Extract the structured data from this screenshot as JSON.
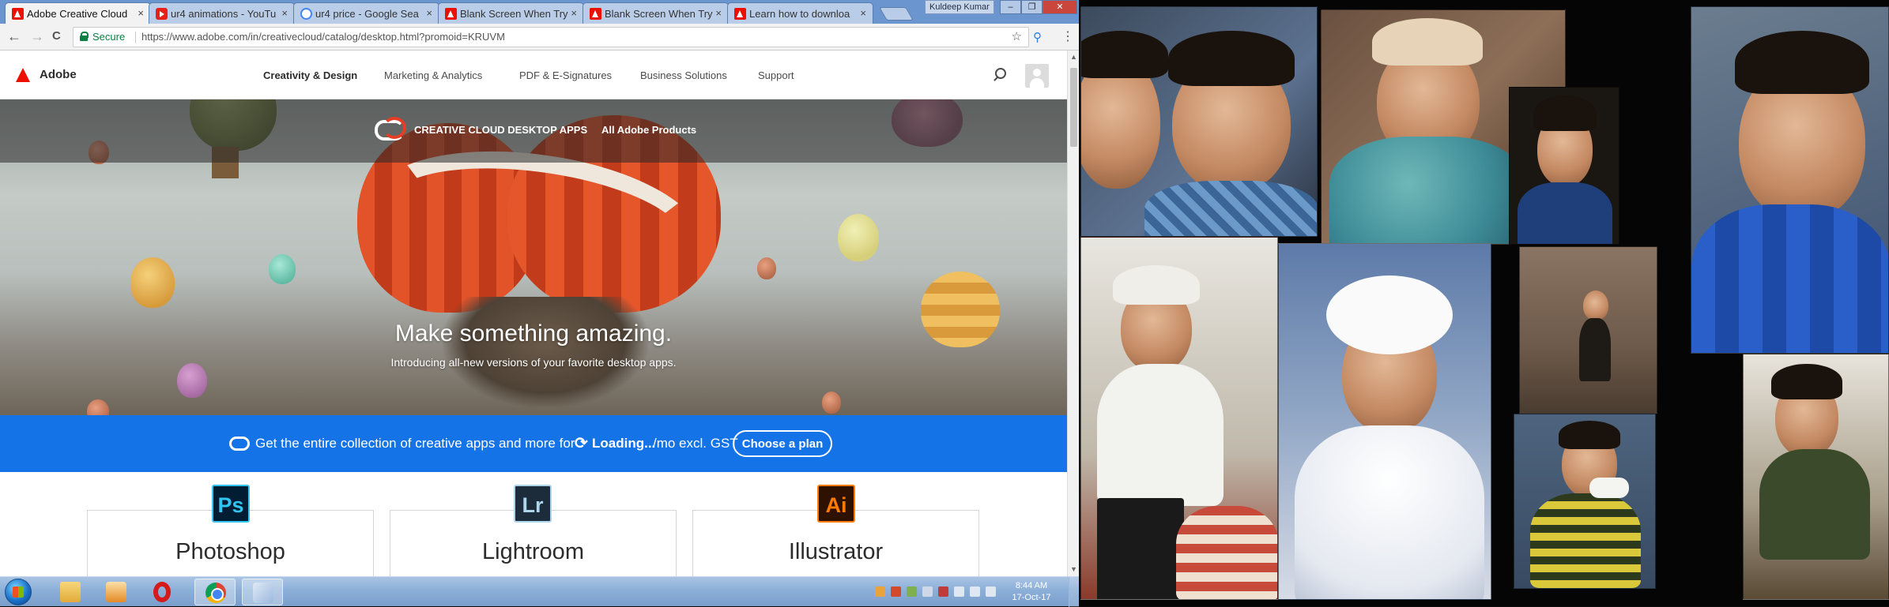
{
  "browser": {
    "tabs": [
      {
        "title": "Adobe Creative Cloud",
        "icon": "adobe-icon",
        "active": true
      },
      {
        "title": "ur4 animations - YouTu",
        "icon": "youtube-icon",
        "active": false
      },
      {
        "title": "ur4 price - Google Sea",
        "icon": "google-icon",
        "active": false
      },
      {
        "title": "Blank Screen When Try",
        "icon": "adobe-icon",
        "active": false
      },
      {
        "title": "Blank Screen When Try",
        "icon": "adobe-icon",
        "active": false
      },
      {
        "title": "Learn how to downloa",
        "icon": "adobe-icon",
        "active": false
      }
    ],
    "tab_close": "×",
    "profile_name": "Kuldeep Kumar",
    "window_buttons": {
      "minimize": "–",
      "maximize": "❐",
      "close": "✕"
    },
    "nav": {
      "back": "←",
      "forward": "→",
      "reload": "C"
    },
    "address": {
      "secure_label": "Secure",
      "url": "https://www.adobe.com/in/creativecloud/catalog/desktop.html?promoid=KRUVM",
      "star": "☆"
    },
    "extension_icon": "search-extension-icon",
    "menu_icon": "⋮"
  },
  "adobe": {
    "brand": "Adobe",
    "nav_items": [
      "Creativity & Design",
      "Marketing & Analytics",
      "PDF & E-Signatures",
      "Business Solutions",
      "Support"
    ],
    "hero": {
      "top_link_primary": "CREATIVE CLOUD DESKTOP APPS",
      "top_link_secondary": "All Adobe Products",
      "title": "Make something amazing.",
      "subtitle": "Introducing all-new versions of your favorite desktop apps."
    },
    "promo": {
      "text": "Get the entire collection of creative apps and more for",
      "refresh_icon": "⟳",
      "loading": "Loading...",
      "suffix": "/mo excl. GST",
      "button": "Choose a plan",
      "color": "#1473e6"
    },
    "cards": [
      {
        "icon_text": "Ps",
        "name": "Photoshop",
        "icon_color": "#31c5f0"
      },
      {
        "icon_text": "Lr",
        "name": "Lightroom",
        "icon_color": "#add5ec"
      },
      {
        "icon_text": "Ai",
        "name": "Illustrator",
        "icon_color": "#ff7c00"
      }
    ],
    "scroll_up": "▲",
    "scroll_down": "▼"
  },
  "taskbar": {
    "apps": [
      "file-explorer-icon",
      "media-player-icon",
      "opera-icon",
      "chrome-icon",
      "paint-icon"
    ],
    "active_app": "chrome-icon",
    "tray_icons": [
      "flag-icon",
      "network-icon",
      "volume-icon",
      "battery-icon",
      "shield-icon",
      "usb-icon",
      "keyboard-icon",
      "monitor-icon"
    ],
    "time": "8:44 AM",
    "date": "17-Oct-17"
  },
  "collage": {
    "description_icons": [
      "family-photo-collage"
    ]
  }
}
